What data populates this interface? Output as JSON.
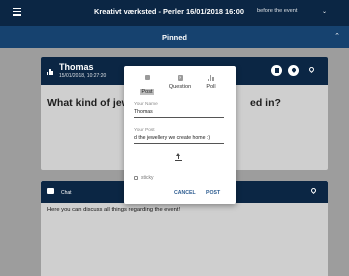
{
  "header": {
    "title": "Kreativt værksted - Perler  16/01/2018 16:00",
    "subtitle": "before the event"
  },
  "pinned": {
    "label": "Pinned"
  },
  "question_card": {
    "author": "Thomas",
    "timestamp": "15/01/2018, 10:27:20",
    "question_text": "What kind of jewel"
  },
  "chat_card": {
    "label": "Chat",
    "message": "Here you can discuss all things regarding the event!"
  },
  "dialog": {
    "tabs": [
      {
        "label": "Post",
        "icon": "flag-icon"
      },
      {
        "label": "Question",
        "icon": "question-icon"
      },
      {
        "label": "Poll",
        "icon": "poll-icon"
      }
    ],
    "name_label": "Your Name",
    "name_value": "Thomas",
    "post_label": "Your Post",
    "post_value": "d the jewellery we create home :)",
    "sticky_label": "sticky",
    "cancel_label": "CANCEL",
    "post_button": "POST"
  },
  "colors": {
    "dark_header": "#0b2644",
    "pinned_bar": "#16426f",
    "overlay_grey": "#9d9d9d",
    "button_text": "#2e5d91"
  }
}
